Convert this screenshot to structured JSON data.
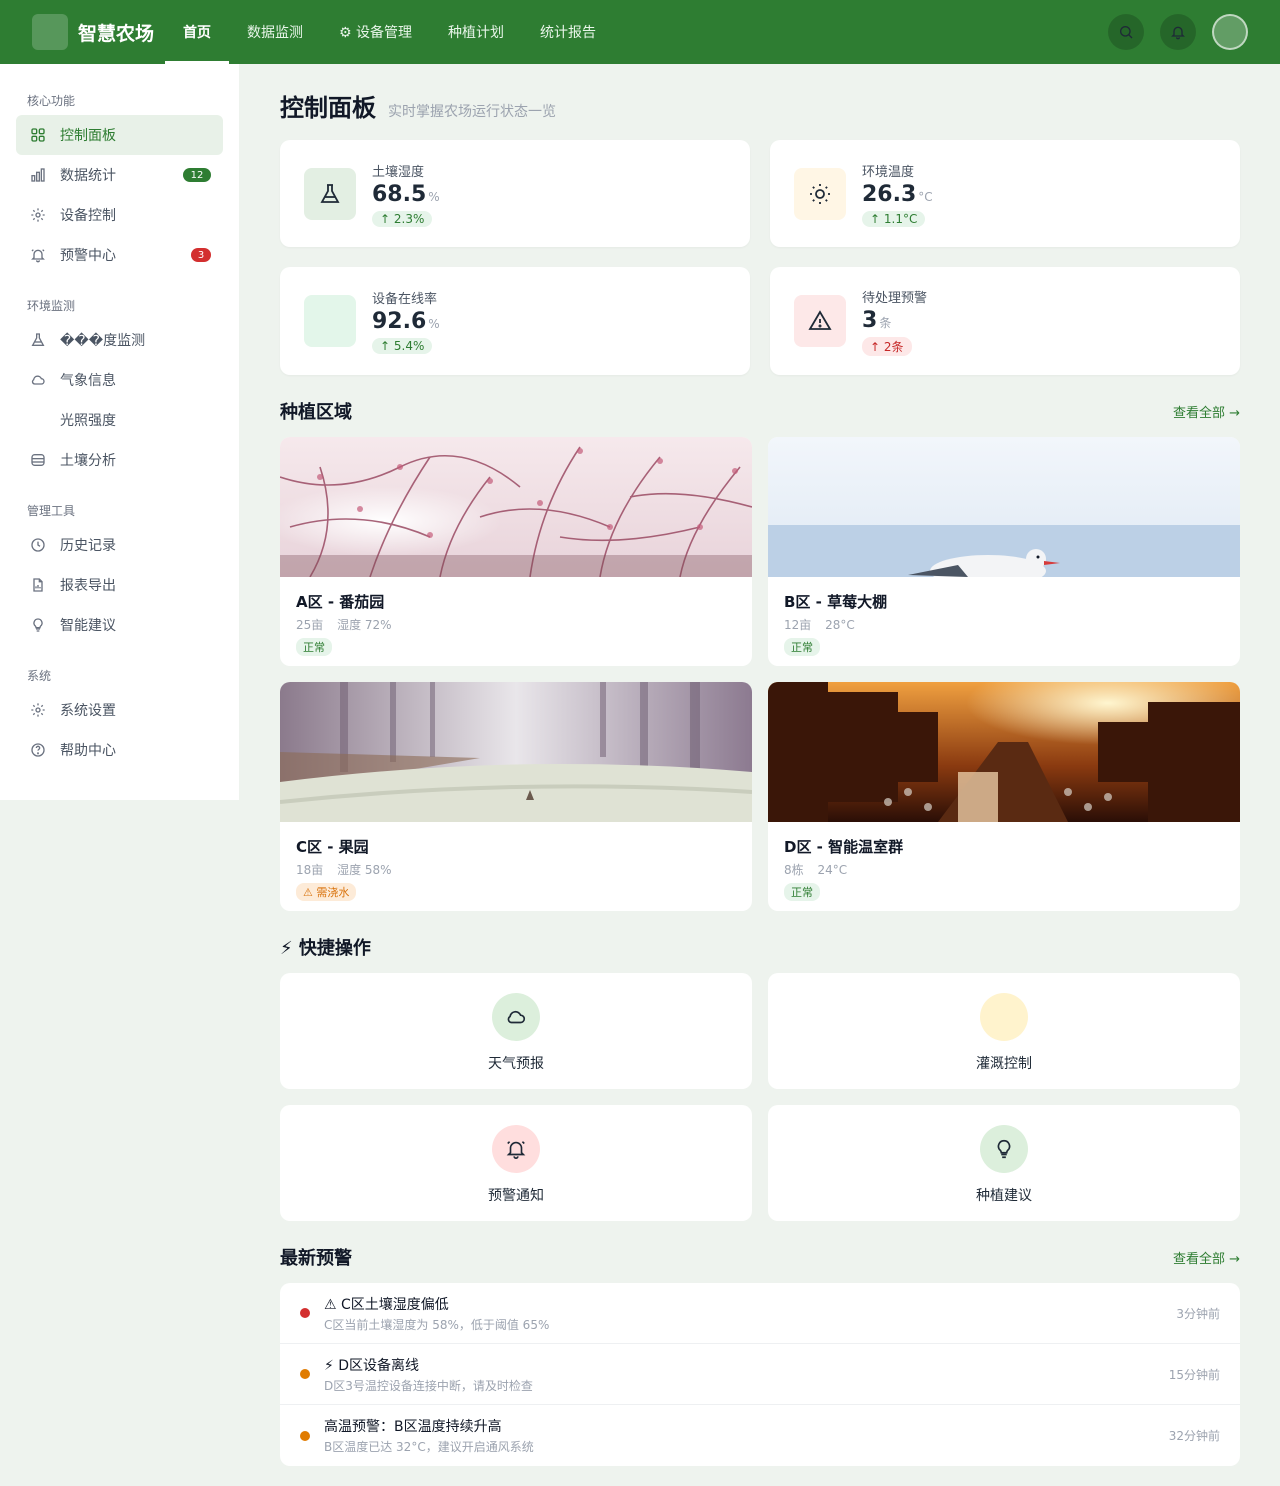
{
  "app": {
    "logo_glyph": "",
    "name": "智慧农场"
  },
  "nav": {
    "tabs": [
      {
        "label": " 首页"
      },
      {
        "label": " 数据监测"
      },
      {
        "label": "⚙ 设备管理"
      },
      {
        "label": " 种植计划"
      },
      {
        "label": " 统计报告"
      }
    ]
  },
  "header_actions": {
    "avatar_glyph": ""
  },
  "sidebar": {
    "groups": [
      {
        "title": "核心功能",
        "items": [
          {
            "label": "控制面板"
          },
          {
            "label": "数据统计",
            "badge": "12"
          },
          {
            "label": "设备控制"
          },
          {
            "label": "预警中心",
            "badge": "3"
          }
        ]
      },
      {
        "title": "环境监测",
        "items": [
          {
            "label": "���度监测"
          },
          {
            "label": "气象信息"
          },
          {
            "label": "光照强度"
          },
          {
            "label": "土壤分析"
          }
        ]
      },
      {
        "title": "管理工具",
        "items": [
          {
            "label": "历史记录"
          },
          {
            "label": "报表导出"
          },
          {
            "label": "智能建议"
          }
        ]
      },
      {
        "title": "系统",
        "items": [
          {
            "label": "系统设置"
          },
          {
            "label": "帮助中心"
          }
        ]
      }
    ],
    "light_icon_glyph": ""
  },
  "page": {
    "title": "控制面板",
    "subtitle": "实时掌握农场运行状态一览"
  },
  "stats": [
    {
      "label": "土壤湿度",
      "value": "68.5",
      "unit": "%",
      "trend": "↑ 2.3%",
      "trend_type": "up",
      "color": "#e3efe3"
    },
    {
      "label": "环境温度",
      "value": "26.3",
      "unit": "°C",
      "trend": "↑ 1.1°C",
      "trend_type": "up",
      "color": "#fff6e5"
    },
    {
      "label": "设备在线率",
      "value": "92.6",
      "unit": "%",
      "trend": "↑ 5.4%",
      "trend_type": "up",
      "color": "#e3f6ea",
      "icon_glyph": ""
    },
    {
      "label": "待处理预警",
      "value": "3",
      "unit": "条",
      "trend": "↑ 2条",
      "trend_type": "bad",
      "color": "#fde8e8"
    }
  ],
  "zones_section": {
    "title": " 种植区域",
    "link": "查看全部 →"
  },
  "zones": [
    {
      "name": "A区 - 番茄园",
      "meta1": " 25亩",
      "meta2": " 湿度 72%",
      "status": " 正常",
      "status_type": "ok"
    },
    {
      "name": "B区 - 草莓大棚",
      "meta1": " 12亩",
      "meta2": " 28°C",
      "status": " 正常",
      "status_type": "ok"
    },
    {
      "name": "C区 - 果园",
      "meta1": " 18亩",
      "meta2": " 湿度 58%",
      "status": "⚠ 需浇水",
      "status_type": "warn"
    },
    {
      "name": "D区 - 智能温室群",
      "meta1": " 8栋",
      "meta2": " 24°C",
      "status": " 正常",
      "status_type": "ok"
    }
  ],
  "quick_section": {
    "title": "⚡ 快捷操作"
  },
  "quick_actions": [
    {
      "label": "天气预报",
      "color": "#dcefdc"
    },
    {
      "label": "灌溉控制",
      "color": "#fff3cd",
      "icon_glyph": ""
    },
    {
      "label": "预警通知",
      "color": "#ffdede"
    },
    {
      "label": "种植建议",
      "color": "#dcefdc"
    }
  ],
  "alerts_section": {
    "title": " 最新预警",
    "link": "查看全部 →"
  },
  "alerts": [
    {
      "title": "⚠ C区土壤湿度偏低",
      "desc": "C区当前土壤湿度为 58%，低于阈值 65%",
      "time": "3分钟前",
      "color": "#d32f2f"
    },
    {
      "title": "⚡ D区设备离线",
      "desc": "D区3号温控设备连接中断，请及时检查",
      "time": "15分钟前",
      "color": "#e07b00"
    },
    {
      "title": " 高温预警：B区温度持续升高",
      "desc": "B区温度已达 32°C，建议开启通风系统",
      "time": "32分钟前",
      "color": "#e07b00"
    }
  ]
}
